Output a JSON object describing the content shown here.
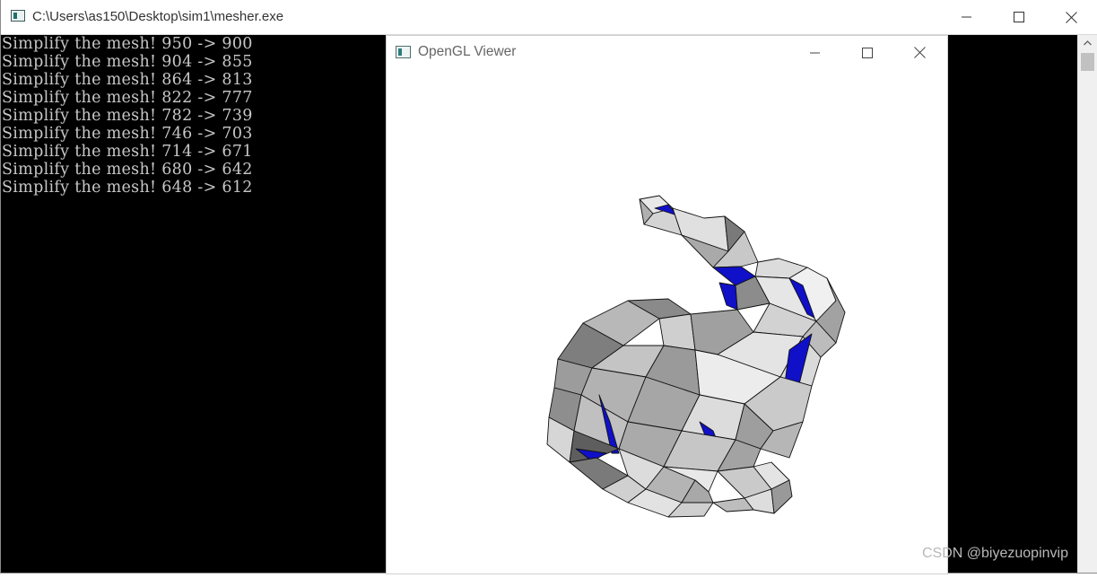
{
  "console": {
    "title": "C:\\Users\\as150\\Desktop\\sim1\\mesher.exe",
    "lines": [
      "Simplify the mesh! 950 -> 900",
      "Simplify the mesh! 904 -> 855",
      "Simplify the mesh! 864 -> 813",
      "Simplify the mesh! 822 -> 777",
      "Simplify the mesh! 782 -> 739",
      "Simplify the mesh! 746 -> 703",
      "Simplify the mesh! 714 -> 671",
      "Simplify the mesh! 680 -> 642",
      "Simplify the mesh! 648 -> 612"
    ]
  },
  "viewer": {
    "title": "OpenGL Viewer",
    "model": "stanford-bunny-mesh"
  },
  "watermark": "CSDN @biyezuopinvip",
  "colors": {
    "console_bg": "#000000",
    "console_text": "#c7c7c7",
    "face_light": "#e6e6e6",
    "face_mid": "#a8a8a8",
    "face_dark": "#6e6e6e",
    "face_blue": "#1010c8"
  },
  "icons": {
    "minimize": "minimize-icon",
    "maximize": "maximize-icon",
    "close": "close-icon"
  }
}
